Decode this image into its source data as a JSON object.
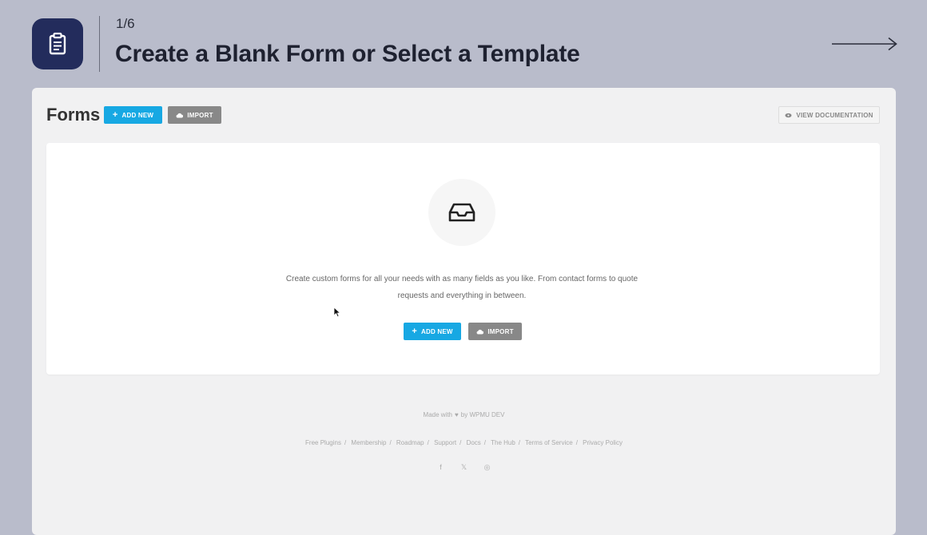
{
  "header": {
    "step": "1/6",
    "title": "Create a Blank Form or Select a Template"
  },
  "icons": {
    "app": "clipboard-icon",
    "next": "arrow-right-icon",
    "empty_state": "inbox-icon"
  },
  "colors": {
    "page_bg": "#b9bccb",
    "app_icon_bg": "#232c5c",
    "primary": "#17a8e3",
    "secondary": "#888888"
  },
  "panel": {
    "title": "Forms",
    "add_new_label": "ADD NEW",
    "import_label": "IMPORT",
    "view_docs_label": "VIEW DOCUMENTATION"
  },
  "empty_state": {
    "description": "Create custom forms for all your needs with as many fields as you like. From contact forms to quote requests and everything in between.",
    "add_new_label": "ADD NEW",
    "import_label": "IMPORT"
  },
  "footer": {
    "made_with": "Made with",
    "made_by": "by WPMU DEV",
    "links": [
      "Free Plugins",
      "Membership",
      "Roadmap",
      "Support",
      "Docs",
      "The Hub",
      "Terms of Service",
      "Privacy Policy"
    ],
    "socials": [
      "f",
      "𝕏",
      "◎"
    ]
  }
}
